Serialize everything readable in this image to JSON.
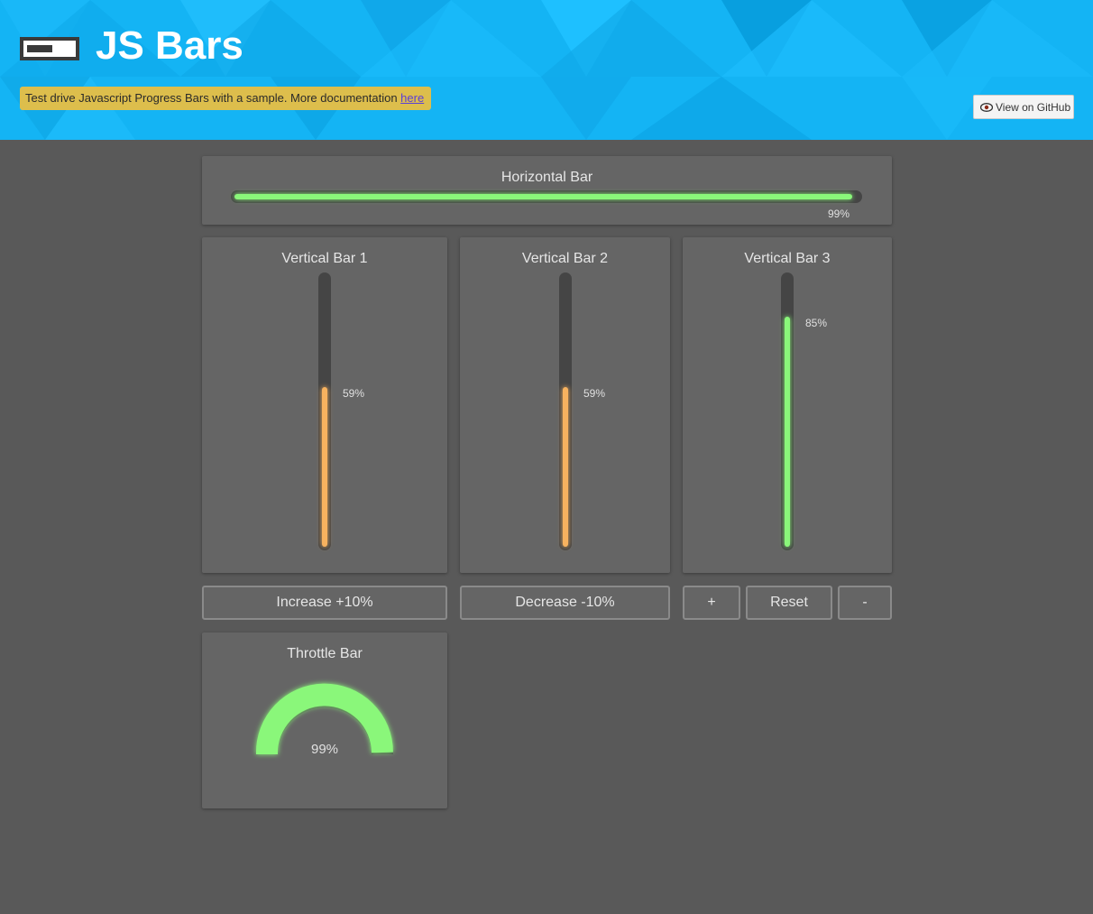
{
  "header": {
    "title": "JS Bars",
    "notice_text": "Test drive Javascript Progress Bars with a sample. More documentation ",
    "notice_link": "here",
    "github_button": "View on GitHub"
  },
  "horizontal": {
    "title": "Horizontal Bar",
    "value": 99,
    "label": "99%"
  },
  "vertical": [
    {
      "title": "Vertical Bar 1",
      "value": 59,
      "label": "59%",
      "color": "#f7b25f"
    },
    {
      "title": "Vertical Bar 2",
      "value": 59,
      "label": "59%",
      "color": "#f7b25f"
    },
    {
      "title": "Vertical Bar 3",
      "value": 85,
      "label": "85%",
      "color": "#8af77a"
    }
  ],
  "buttons": {
    "increase": "Increase +10%",
    "decrease": "Decrease -10%",
    "plus": "+",
    "reset": "Reset",
    "minus": "-"
  },
  "throttle": {
    "title": "Throttle Bar",
    "value": 99,
    "label": "99%",
    "color": "#8af77a"
  },
  "colors": {
    "header": "#14b4f4",
    "page": "#595959",
    "panel": "#656565",
    "notice": "#ddbe4c"
  }
}
